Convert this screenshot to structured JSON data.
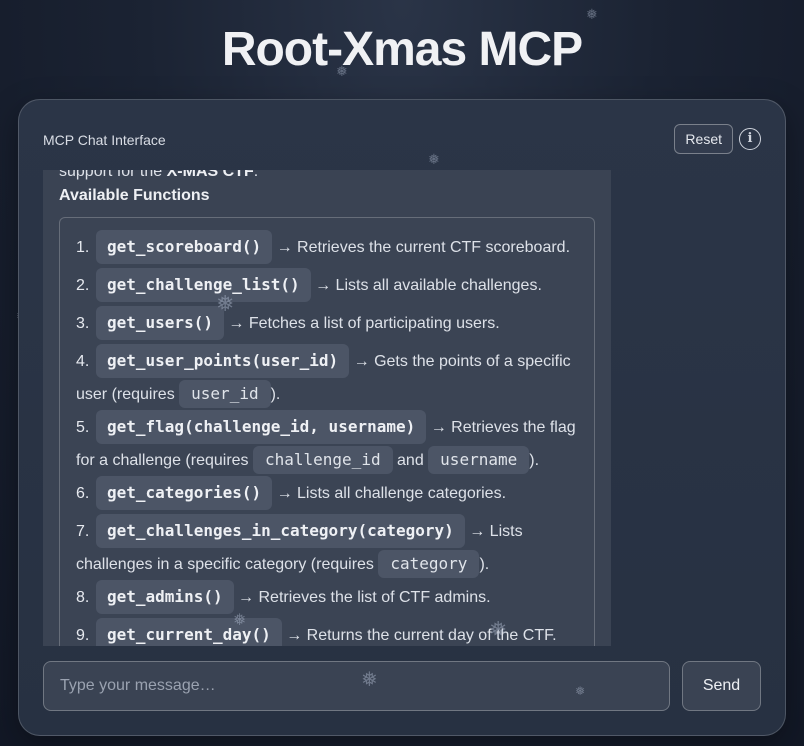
{
  "page": {
    "title": "Root-Xmas MCP"
  },
  "panel": {
    "title": "MCP Chat Interface",
    "reset_label": "Reset",
    "info_label": "i"
  },
  "message": {
    "intro_prefix": "support for the ",
    "intro_bold": "X-MAS CTF",
    "intro_suffix": ":",
    "heading": "Available Functions",
    "functions": [
      {
        "num": "1.",
        "name": "get_scoreboard()",
        "desc": " → Retrieves the current CTF scoreboard."
      },
      {
        "num": "2.",
        "name": "get_challenge_list()",
        "desc": " → Lists all available challenges."
      },
      {
        "num": "3.",
        "name": "get_users()",
        "desc": " → Fetches a list of participating users."
      },
      {
        "num": "4.",
        "name": "get_user_points(user_id)",
        "desc": " → Gets the points of a specific user (requires ",
        "params": [
          "user_id"
        ],
        "tail": ")."
      },
      {
        "num": "5.",
        "name": "get_flag(challenge_id, username)",
        "desc": " → Retrieves the flag for a challenge (requires ",
        "params": [
          "challenge_id",
          "username"
        ],
        "joiner": " and ",
        "tail": ")."
      },
      {
        "num": "6.",
        "name": "get_categories()",
        "desc": " → Lists all challenge categories."
      },
      {
        "num": "7.",
        "name": "get_challenges_in_category(category)",
        "desc": " → Lists challenges in a specific category (requires ",
        "params": [
          "category"
        ],
        "tail": ")."
      },
      {
        "num": "8.",
        "name": "get_admins()",
        "desc": " → Retrieves the list of CTF admins."
      },
      {
        "num": "9.",
        "name": "get_current_day()",
        "desc": " → Returns the current day of the CTF."
      }
    ]
  },
  "composer": {
    "placeholder": "Type your message…",
    "send_label": "Send"
  },
  "icons": {
    "snowflake": "snowflake-icon",
    "info": "info-icon"
  },
  "colors": {
    "background": "#1b2333",
    "panel": "#2b3547",
    "bubble": "#3a4353",
    "code_chip": "#4c5566"
  }
}
